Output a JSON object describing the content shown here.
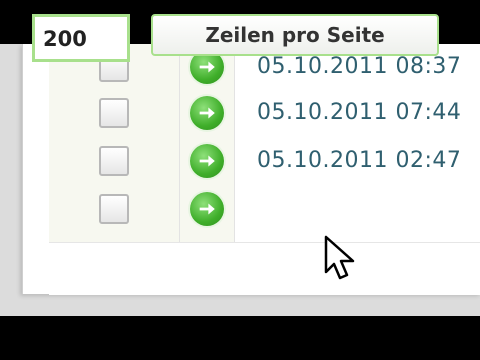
{
  "rows": [
    {
      "date": "05.10.2011 08:37"
    },
    {
      "date": "05.10.2011 07:44"
    },
    {
      "date": "05.10.2011 02:47"
    }
  ],
  "pagination": {
    "rows_value": "200",
    "button_label": "Zeilen pro Seite"
  },
  "icons": {
    "row_icon": "arrow-right-circle-icon",
    "cursor": "mouse-pointer-icon"
  }
}
